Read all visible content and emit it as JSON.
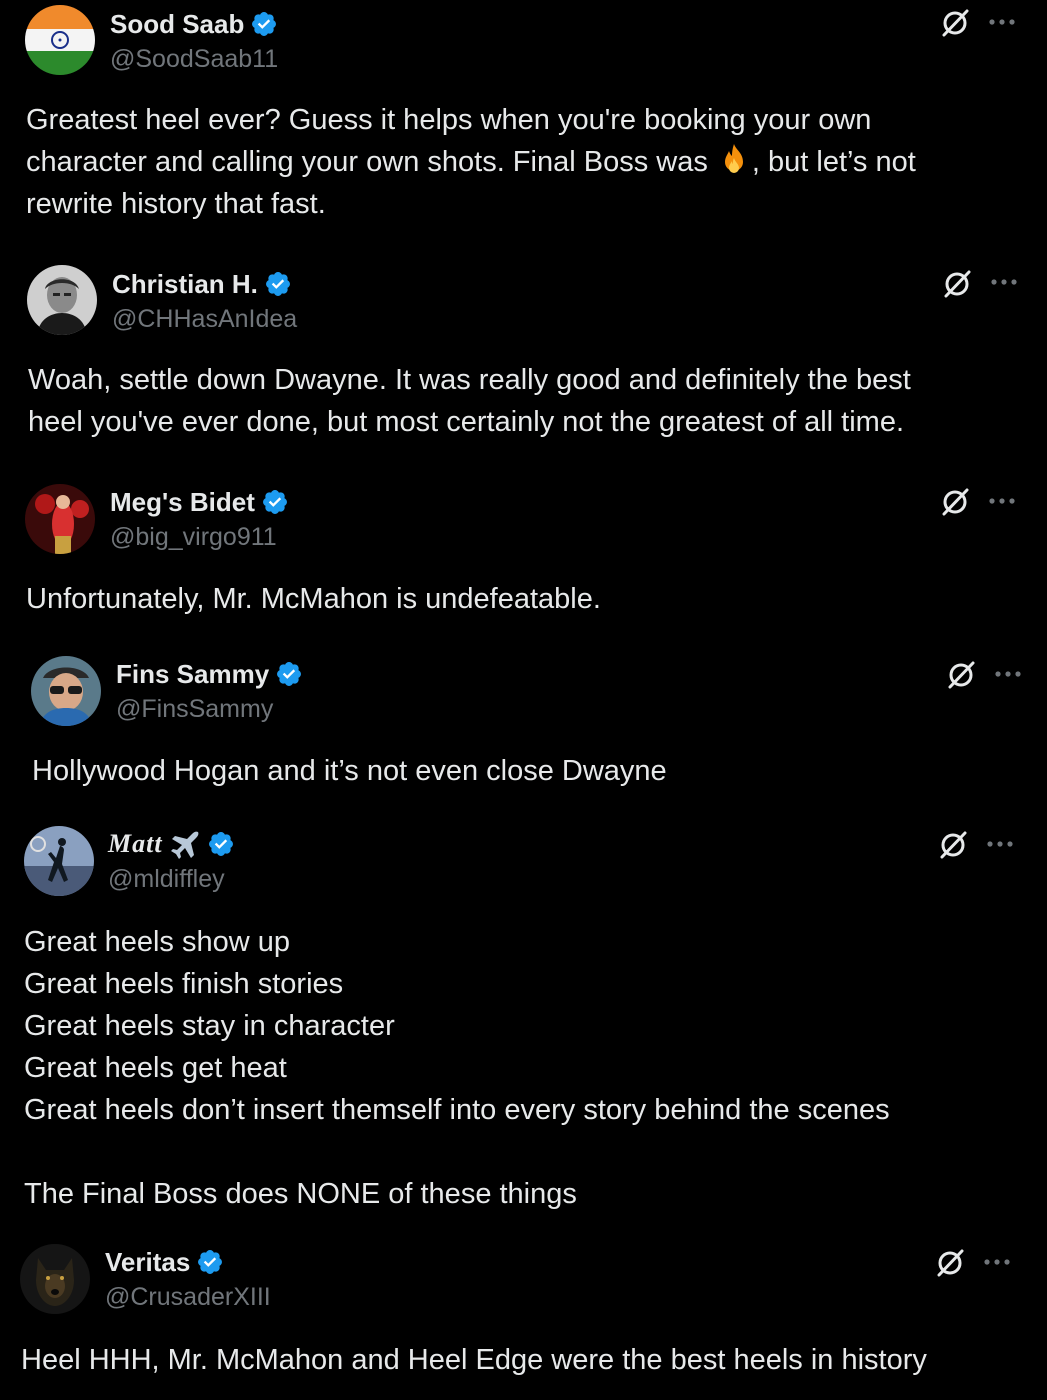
{
  "colors": {
    "background": "#000000",
    "text": "#e7e9ea",
    "secondary_text": "#71767b",
    "verified_blue": "#1d9bf0"
  },
  "icons": {
    "verified": "verified-badge-icon",
    "grok": "grok-icon",
    "more": "more-options-icon",
    "fire": "fire-emoji",
    "airplane": "airplane-emoji"
  },
  "posts": [
    {
      "display_name": "Sood Saab",
      "handle": "@SoodSaab11",
      "text_before_emoji": "Greatest heel ever? Guess it helps when you're booking your own\ncharacter and calling your own shots. Final Boss was ",
      "text_after_emoji": ", but let’s not\nrewrite history that fast."
    },
    {
      "display_name": "Christian H.",
      "handle": "@CHHasAnIdea",
      "text": "Woah, settle down Dwayne. It was really good and definitely the best\nheel you've ever done, but most certainly not the greatest of all time."
    },
    {
      "display_name": "Meg's Bidet",
      "handle": "@big_virgo911",
      "text": "Unfortunately, Mr. McMahon is undefeatable."
    },
    {
      "display_name": "Fins Sammy",
      "handle": "@FinsSammy",
      "text": " Hollywood Hogan and it’s not even close Dwayne"
    },
    {
      "display_name": "Matt",
      "handle": "@mldiffley",
      "text": "Great heels show up\nGreat heels finish stories\nGreat heels stay in character\nGreat heels get heat\nGreat heels don’t insert themself into every story behind the scenes\n\nThe Final Boss does NONE of these things"
    },
    {
      "display_name": "Veritas",
      "handle": "@CrusaderXIII",
      "text": "Heel HHH, Mr. McMahon and Heel Edge were the best heels in history"
    }
  ]
}
